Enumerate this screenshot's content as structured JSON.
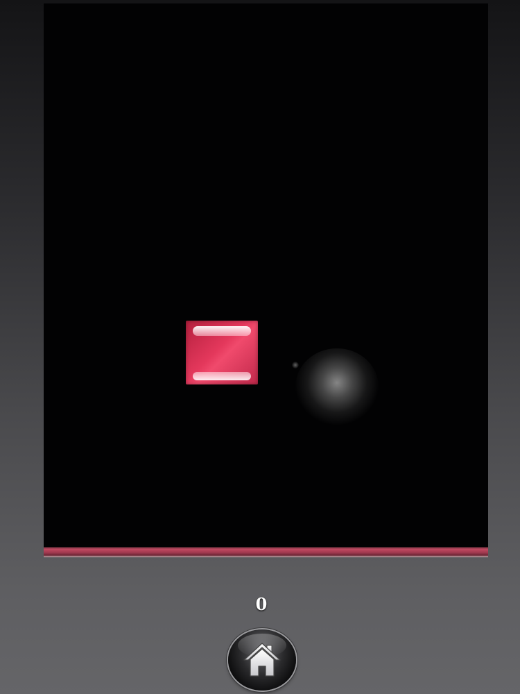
{
  "game": {
    "score": "0",
    "home_button_icon": "home-icon"
  },
  "colors": {
    "background_dark": "#141416",
    "background_light": "#656568",
    "screen": "#020203",
    "block": "#e4385c",
    "floor": "#c24a62",
    "ball": "#8c8c8c"
  }
}
